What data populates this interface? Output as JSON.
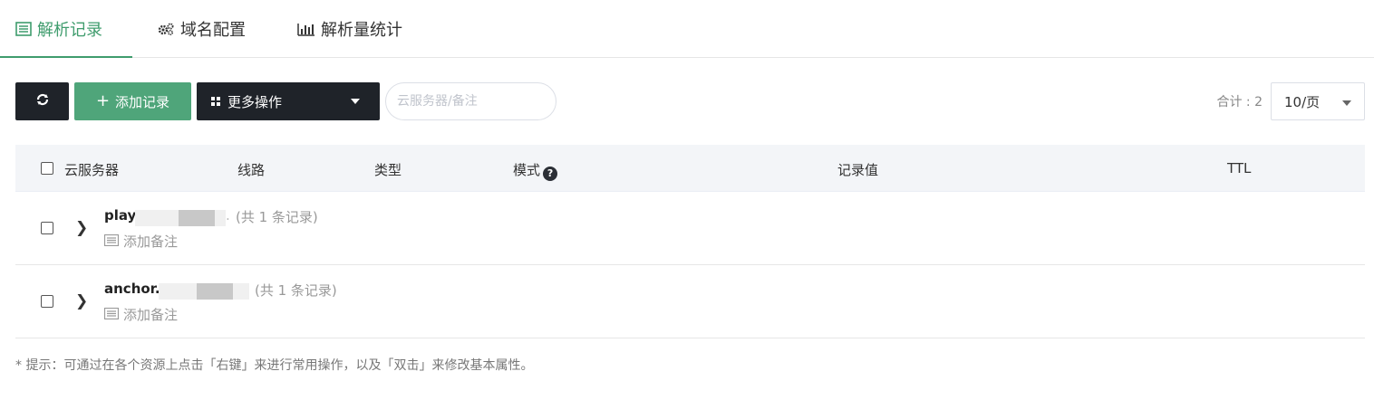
{
  "tabs": [
    {
      "label": "解析记录",
      "icon": "list-icon",
      "active": true
    },
    {
      "label": "域名配置",
      "icon": "gears-icon",
      "active": false
    },
    {
      "label": "解析量统计",
      "icon": "bar-chart-icon",
      "active": false
    }
  ],
  "toolbar": {
    "refresh_icon": "refresh-icon",
    "add_label": "添加记录",
    "more_label": "更多操作",
    "search_placeholder": "云服务器/备注",
    "total_label": "合计 : 2",
    "page_size": "10/页"
  },
  "table": {
    "columns": [
      "云服务器",
      "线路",
      "类型",
      "模式",
      "记录值",
      "TTL"
    ],
    "rows": [
      {
        "domain": "play.",
        "domain_tail": ".",
        "count": "(共 1 条记录)",
        "remark": "添加备注"
      },
      {
        "domain": "anchor.",
        "domain_tail": "",
        "count": "(共 1 条记录)",
        "remark": "添加备注"
      }
    ]
  },
  "tip": "* 提示：可通过在各个资源上点击「右键」来进行常用操作，以及「双击」来修改基本属性。",
  "colors": {
    "accent": "#3f9c6d",
    "dark_button": "#1f2329",
    "add_button": "#4fa57a"
  }
}
